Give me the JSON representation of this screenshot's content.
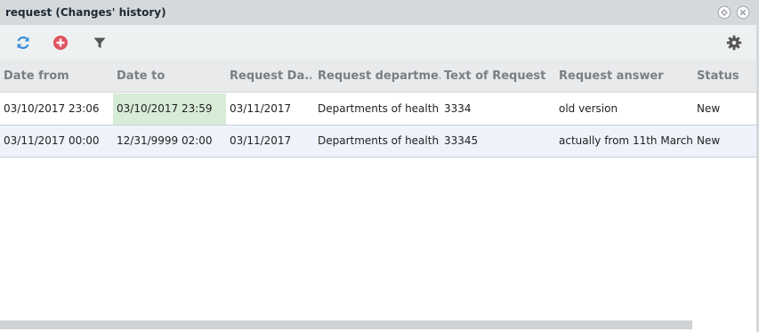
{
  "window": {
    "title": "request (Changes' history)",
    "restore_icon": "restore-icon",
    "close_icon": "close-icon"
  },
  "toolbar": {
    "items": [
      {
        "name": "refresh",
        "icon": "refresh-icon",
        "color": "#3a8fd9"
      },
      {
        "name": "add",
        "icon": "plus-circle-icon",
        "color": "#e0535d"
      },
      {
        "name": "filter",
        "icon": "filter-icon",
        "color": "#555555"
      },
      {
        "name": "settings",
        "icon": "gear-icon",
        "color": "#555555"
      }
    ]
  },
  "table": {
    "columns": [
      "Date from",
      "Date to",
      "Request Da...",
      "Request departme...",
      "Text of Request",
      "Request answer",
      "Status"
    ],
    "rows": [
      [
        "03/10/2017 23:06",
        "03/10/2017 23:59",
        "03/11/2017",
        "Departments of health",
        "3334",
        "old version",
        "New"
      ],
      [
        "03/11/2017 00:00",
        "12/31/9999 02:00",
        "03/11/2017",
        "Departments of health",
        "33345",
        "actually from 11th March",
        "New"
      ]
    ],
    "highlight_color": "#d7ecd7"
  }
}
